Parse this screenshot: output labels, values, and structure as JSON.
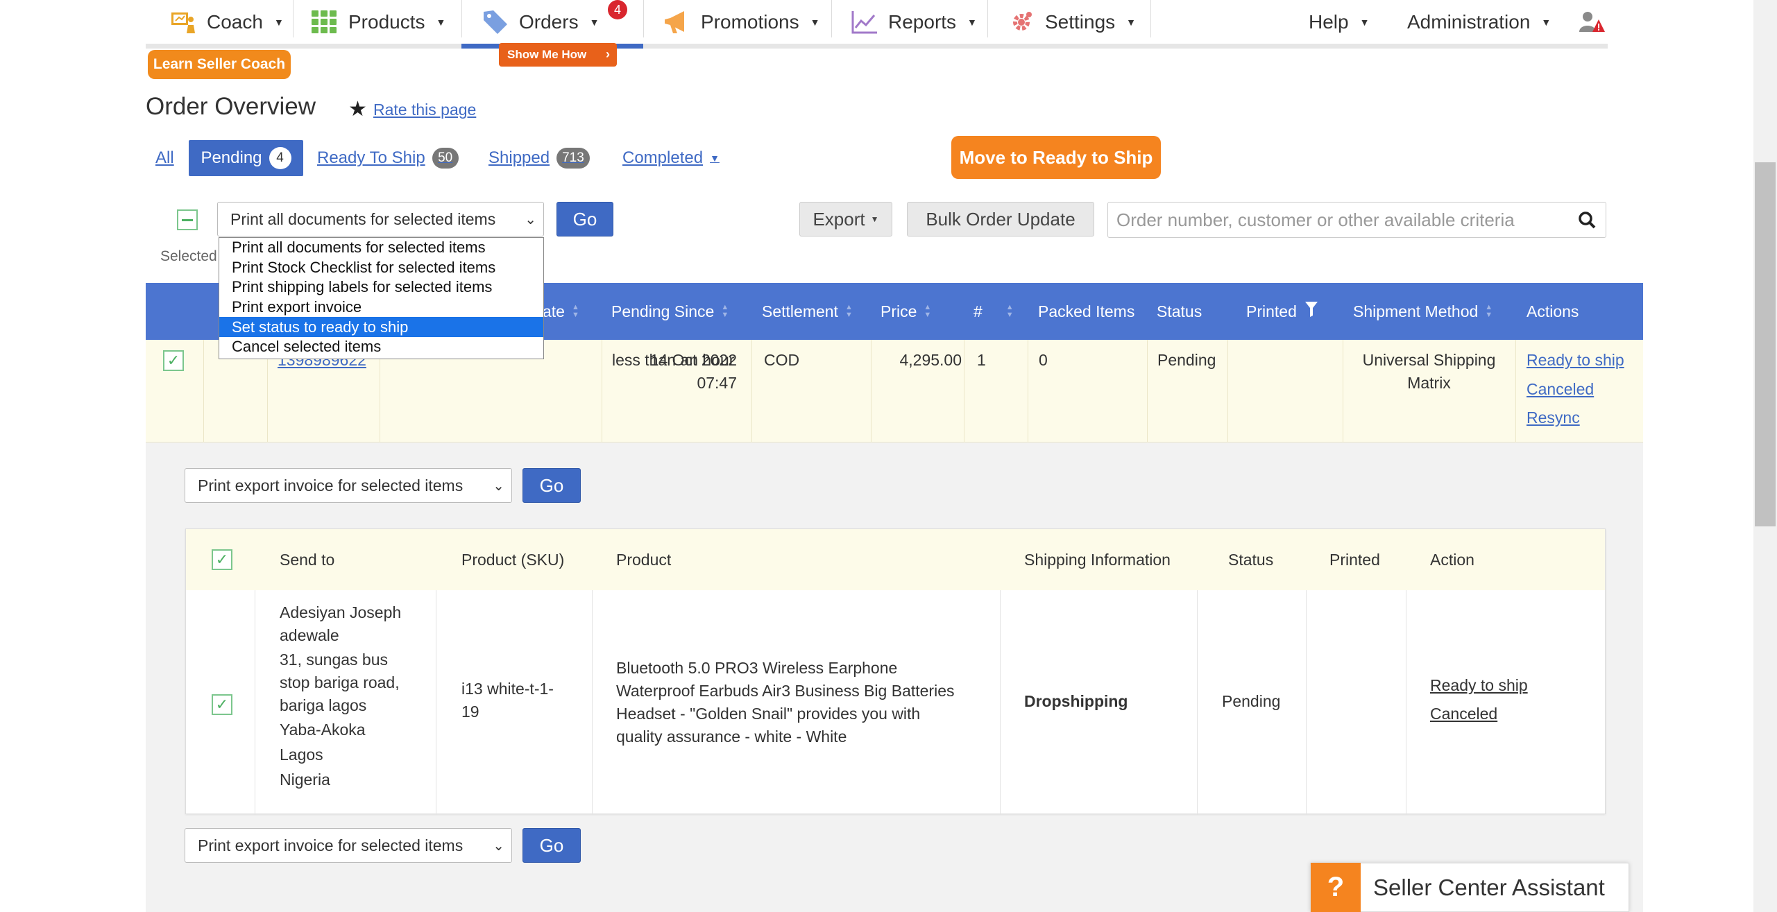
{
  "nav": {
    "items": [
      {
        "label": "Coach",
        "icon": "coach-icon"
      },
      {
        "label": "Products",
        "icon": "grid-icon"
      },
      {
        "label": "Orders",
        "icon": "tag-icon",
        "badge": "4"
      },
      {
        "label": "Promotions",
        "icon": "megaphone-icon"
      },
      {
        "label": "Reports",
        "icon": "chart-icon"
      },
      {
        "label": "Settings",
        "icon": "gear-icon"
      }
    ],
    "help": "Help",
    "administration": "Administration",
    "show_me_how": "Show Me How",
    "learn_coach": "Learn Seller Coach"
  },
  "page": {
    "title": "Order Overview",
    "rate_link": "Rate this page",
    "move_ready_button": "Move to Ready to Ship"
  },
  "tabs": {
    "all": "All",
    "pending": {
      "label": "Pending",
      "count": "4"
    },
    "ready_to_ship": {
      "label": "Ready To Ship",
      "count": "50"
    },
    "shipped": {
      "label": "Shipped",
      "count": "713"
    },
    "completed": "Completed"
  },
  "toolbar": {
    "bulk_select_value": "Print all documents for selected items",
    "go": "Go",
    "selected_label": "Selected",
    "export": "Export",
    "bulk_update": "Bulk Order Update",
    "search_placeholder": "Order number, customer or other available criteria"
  },
  "dropdown": {
    "options": [
      "Print all documents for selected items",
      "Print Stock Checklist for selected items",
      "Print shipping labels for selected items",
      "Print export invoice",
      "Set status to ready to ship",
      "Cancel selected items"
    ],
    "highlighted_index": 4
  },
  "table": {
    "headers": {
      "date": "ate",
      "pending_since": "Pending Since",
      "settlement": "Settlement",
      "price": "Price",
      "qty": "#",
      "packed": "Packed Items",
      "status": "Status",
      "printed": "Printed",
      "shipment": "Shipment Method",
      "actions": "Actions"
    },
    "row": {
      "order_number": "1398989622",
      "date_line1": "14 Oct 2022",
      "date_line2": "07:47",
      "pending_since": "less than an hour",
      "settlement": "COD",
      "price": "4,295.00",
      "qty": "1",
      "packed": "0",
      "status": "Pending",
      "shipment_line1": "Universal Shipping",
      "shipment_line2": "Matrix",
      "actions": [
        "Ready to ship",
        "Canceled",
        "Resync"
      ]
    }
  },
  "detail": {
    "export_select_value": "Print export invoice for selected items",
    "go": "Go",
    "headers": {
      "send_to": "Send to",
      "sku": "Product (SKU)",
      "product": "Product",
      "shipping": "Shipping Information",
      "status": "Status",
      "printed": "Printed",
      "action": "Action"
    },
    "item": {
      "address": [
        "Adesiyan Joseph",
        "adewale",
        "31, sungas bus",
        "stop bariga road,",
        "bariga lagos",
        "Yaba-Akoka",
        "Lagos",
        "Nigeria"
      ],
      "sku_line1": "i13 white-t-1-",
      "sku_line2": "19",
      "product_lines": [
        "Bluetooth 5.0 PRO3 Wireless Earphone",
        "Waterproof Earbuds Air3 Business Big Batteries",
        "Headset - \"Golden Snail\" provides you with",
        "quality assurance - white - White"
      ],
      "shipping": "Dropshipping",
      "status": "Pending",
      "actions": [
        "Ready to ship",
        "Canceled"
      ]
    }
  },
  "assistant": {
    "label": "Seller Center Assistant",
    "q": "?"
  },
  "colors": {
    "primary": "#3f6ac4",
    "header": "#4c75d0",
    "orange": "#f5841f",
    "row_bg": "#fdfbe9",
    "badge_red": "#d9262e"
  }
}
